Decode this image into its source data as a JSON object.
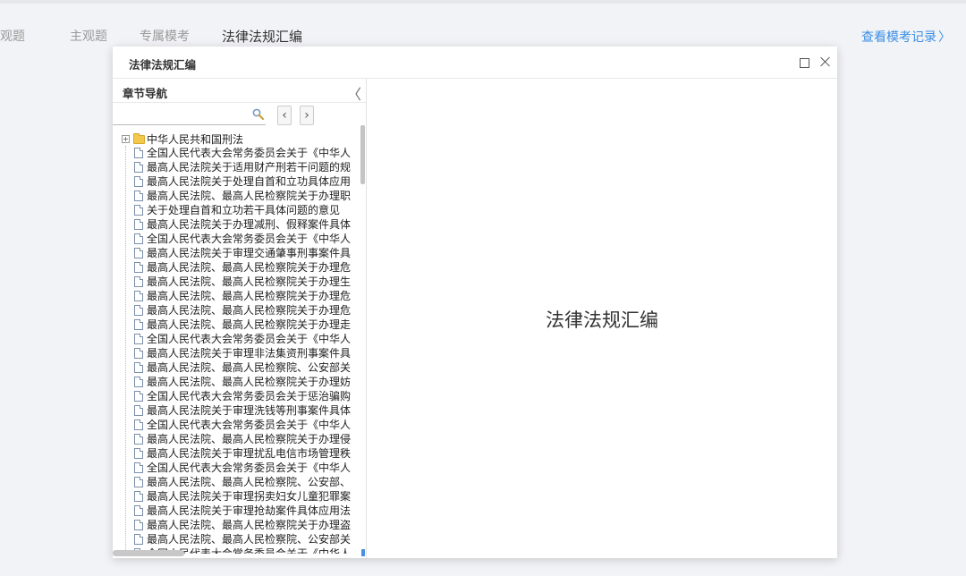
{
  "tabs": [
    {
      "label": "客观题"
    },
    {
      "label": "主观题"
    },
    {
      "label": "专属模考"
    },
    {
      "label": "法律法规汇编"
    }
  ],
  "history_link": "查看模考记录",
  "modal": {
    "title": "法律法规汇编",
    "nav": {
      "title": "章节导航",
      "search_value": "",
      "tree": {
        "root": "中华人民共和国刑法",
        "items": [
          "全国人民代表大会常务委员会关于《中华人",
          "最高人民法院关于适用财产刑若干问题的规",
          "最高人民法院关于处理自首和立功具体应用",
          "最高人民法院、最高人民检察院关于办理职",
          "关于处理自首和立功若干具体问题的意见",
          "最高人民法院关于办理减刑、假释案件具体",
          "全国人民代表大会常务委员会关于《中华人",
          "最高人民法院关于审理交通肇事刑事案件具",
          "最高人民法院、最高人民检察院关于办理危",
          "最高人民法院、最高人民检察院关于办理生",
          "最高人民法院、最高人民检察院关于办理危",
          "最高人民法院、最高人民检察院关于办理危",
          "最高人民法院、最高人民检察院关于办理走",
          "全国人民代表大会常务委员会关于《中华人",
          "最高人民法院关于审理非法集资刑事案件具",
          "最高人民法院、最高人民检察院、公安部关",
          "最高人民法院、最高人民检察院关于办理妨",
          "全国人民代表大会常务委员会关于惩治骗购",
          "最高人民法院关于审理洗钱等刑事案件具体",
          "全国人民代表大会常务委员会关于《中华人",
          "最高人民法院、最高人民检察院关于办理侵",
          "最高人民法院关于审理扰乱电信市场管理秩",
          "全国人民代表大会常务委员会关于《中华人",
          "最高人民法院、最高人民检察院、公安部、",
          "最高人民法院关于审理拐卖妇女儿童犯罪案",
          "最高人民法院关于审理抢劫案件具体应用法",
          "最高人民法院、最高人民检察院关于办理盗",
          "最高人民法院、最高人民检察院、公安部关",
          "全国人民代表大会常务委员会关于《中华人"
        ]
      }
    },
    "content_title": "法律法规汇编"
  },
  "icons": {
    "search": "magnifier-icon",
    "maximize": "square-icon",
    "close": "x-icon",
    "collapse": "chevron-left-icon",
    "prev": "chevron-left-icon",
    "next": "chevron-right-icon",
    "folder": "folder-icon",
    "document": "document-icon"
  },
  "colors": {
    "link": "#3a8ee6",
    "background": "#f2f3f6",
    "scroll_accent": "#4a90e2"
  }
}
